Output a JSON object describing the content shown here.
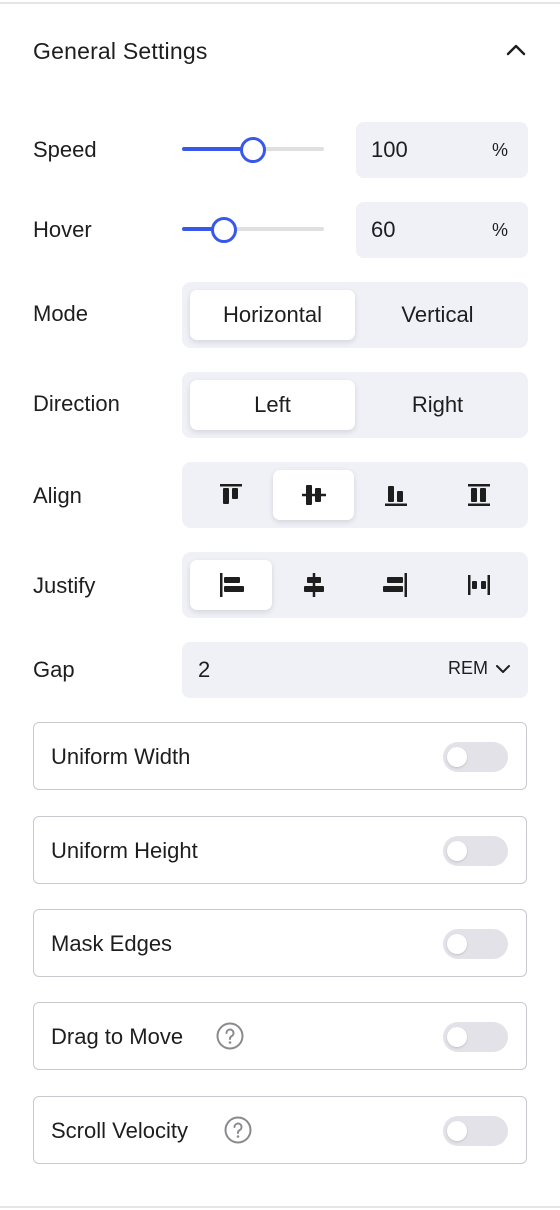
{
  "panel": {
    "title": "General Settings",
    "collapse_icon": "chevron-up-icon"
  },
  "speed": {
    "label": "Speed",
    "value": "100",
    "unit": "%",
    "slider_fraction": 0.49
  },
  "hover": {
    "label": "Hover",
    "value": "60",
    "unit": "%",
    "slider_fraction": 0.29
  },
  "mode": {
    "label": "Mode",
    "options": [
      "Horizontal",
      "Vertical"
    ],
    "selected": "Horizontal"
  },
  "direction": {
    "label": "Direction",
    "options": [
      "Left",
      "Right"
    ],
    "selected": "Left"
  },
  "align": {
    "label": "Align",
    "options": [
      "align-top-icon",
      "align-center-icon",
      "align-bottom-icon",
      "align-stretch-icon"
    ],
    "selected": "align-center-icon"
  },
  "justify": {
    "label": "Justify",
    "options": [
      "justify-start-icon",
      "justify-center-icon",
      "justify-end-icon",
      "justify-space-between-icon"
    ],
    "selected": "justify-start-icon"
  },
  "gap": {
    "label": "Gap",
    "value": "2",
    "unit": "REM"
  },
  "toggles": [
    {
      "label": "Uniform Width",
      "enabled": false,
      "help": false
    },
    {
      "label": "Uniform Height",
      "enabled": false,
      "help": false
    },
    {
      "label": "Mask Edges",
      "enabled": false,
      "help": false
    },
    {
      "label": "Drag to Move",
      "enabled": false,
      "help": true
    },
    {
      "label": "Scroll Velocity",
      "enabled": false,
      "help": true
    }
  ],
  "colors": {
    "accent": "#3858e9",
    "control_bg": "#f0f0f7",
    "toggle_off": "#e2e2e8"
  }
}
